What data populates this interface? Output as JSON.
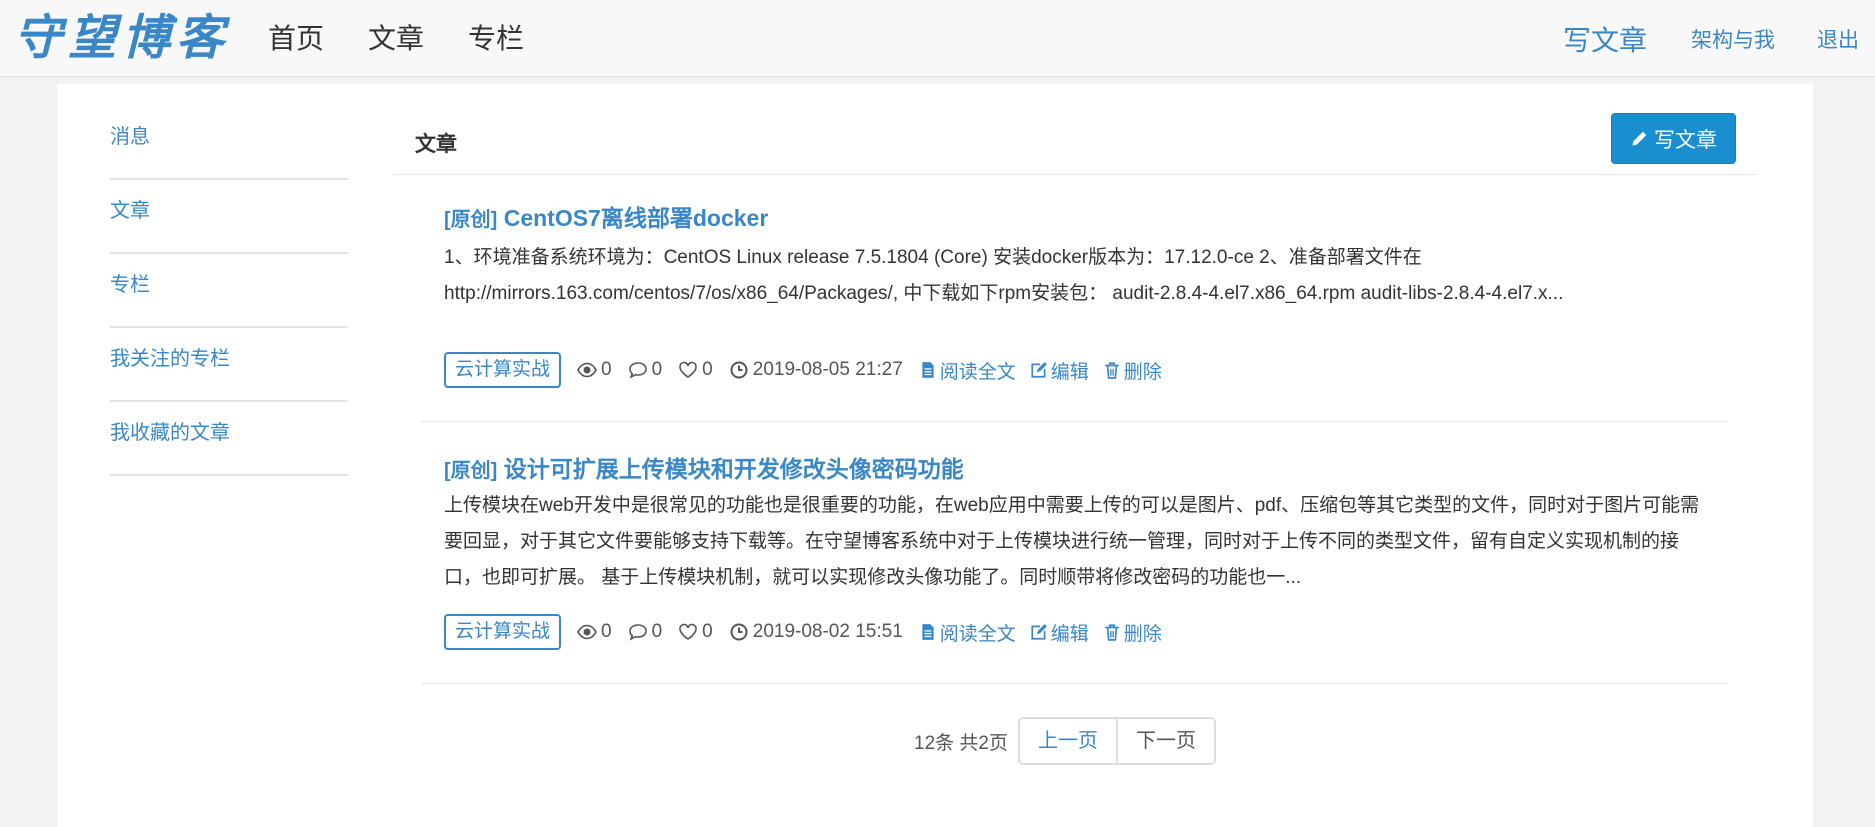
{
  "navbar": {
    "brand": "守望博客",
    "links": [
      "首页",
      "文章",
      "专栏"
    ],
    "write": "写文章",
    "arch": "架构与我",
    "logout": "退出"
  },
  "sidebar": {
    "items": [
      "消息",
      "文章",
      "专栏",
      "我关注的专栏",
      "我收藏的文章"
    ]
  },
  "main": {
    "title": "文章",
    "write_button": "写文章",
    "articles": [
      {
        "prefix": "[原创]",
        "title": "CentOS7离线部署docker",
        "summary": "1、环境准备系统环境为：CentOS Linux release 7.5.1804 (Core) 安装docker版本为：17.12.0-ce 2、准备部署文件在 http://mirrors.163.com/centos/7/os/x86_64/Packages/, 中下载如下rpm安装包：  audit-2.8.4-4.el7.x86_64.rpm audit-libs-2.8.4-4.el7.x...",
        "tag": "云计算实战",
        "views": "0",
        "comments": "0",
        "likes": "0",
        "date": "2019-08-05 21:27",
        "read": "阅读全文",
        "edit": "编辑",
        "delete": "删除"
      },
      {
        "prefix": "[原创]",
        "title": "设计可扩展上传模块和开发修改头像密码功能",
        "summary": "上传模块在web开发中是很常见的功能也是很重要的功能，在web应用中需要上传的可以是图片、pdf、压缩包等其它类型的文件，同时对于图片可能需要回显，对于其它文件要能够支持下载等。在守望博客系统中对于上传模块进行统一管理，同时对于上传不同的类型文件，留有自定义实现机制的接口，也即可扩展。 基于上传模块机制，就可以实现修改头像功能了。同时顺带将修改密码的功能也一...",
        "tag": "云计算实战",
        "views": "0",
        "comments": "0",
        "likes": "0",
        "date": "2019-08-02 15:51",
        "read": "阅读全文",
        "edit": "编辑",
        "delete": "删除"
      }
    ]
  },
  "pager": {
    "info": "12条 共2页",
    "prev": "上一页",
    "next": "下一页"
  },
  "colors": {
    "accent": "#3a87c7",
    "button": "#1a8fd0"
  }
}
